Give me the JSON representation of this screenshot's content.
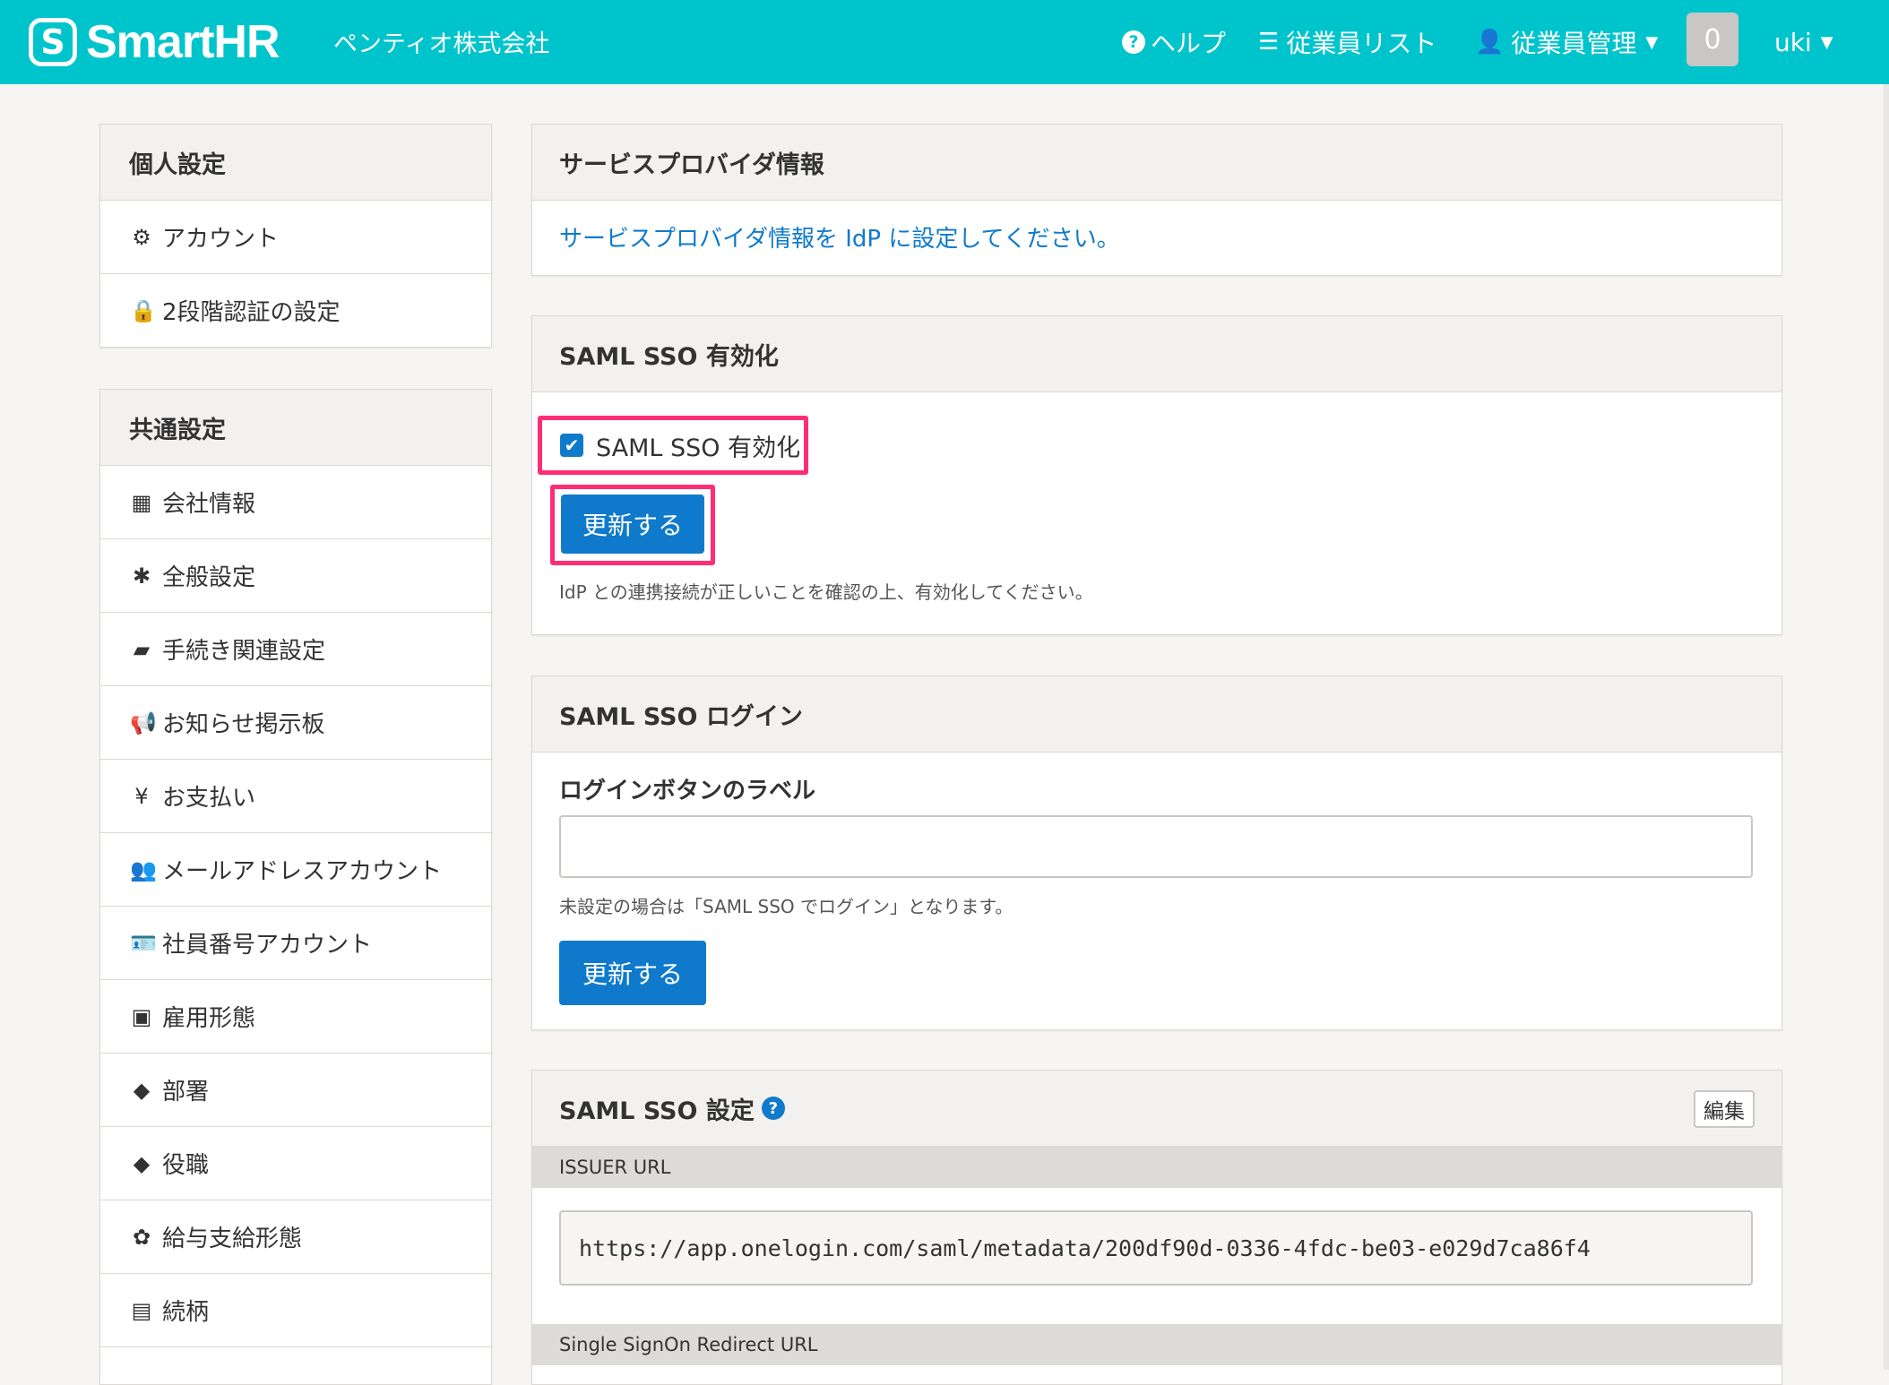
{
  "header": {
    "logo_mark": "S",
    "logo_text": "SmartHR",
    "company": "ペンティオ株式会社",
    "nav_help": "ヘルプ",
    "nav_employee_list": "従業員リスト",
    "nav_employee_manage": "従業員管理",
    "notification_count": "0",
    "user": "uki",
    "brand_color": "#00c4cc"
  },
  "sidebar": {
    "personal_title": "個人設定",
    "personal_items": [
      {
        "label": "アカウント",
        "icon": "gear-icon"
      },
      {
        "label": "2段階認証の設定",
        "icon": "lock-icon"
      }
    ],
    "common_title": "共通設定",
    "common_items": [
      {
        "label": "会社情報",
        "icon": "building-icon"
      },
      {
        "label": "全般設定",
        "icon": "asterisk-icon"
      },
      {
        "label": "手続き関連設定",
        "icon": "book-icon"
      },
      {
        "label": "お知らせ掲示板",
        "icon": "megaphone-icon"
      },
      {
        "label": "お支払い",
        "icon": "yen-icon"
      },
      {
        "label": "メールアドレスアカウント",
        "icon": "users-icon"
      },
      {
        "label": "社員番号アカウント",
        "icon": "id-card-icon"
      },
      {
        "label": "雇用形態",
        "icon": "badge-icon"
      },
      {
        "label": "部署",
        "icon": "tags-icon"
      },
      {
        "label": "役職",
        "icon": "tag-icon"
      },
      {
        "label": "給与支給形態",
        "icon": "money-icon"
      },
      {
        "label": "続柄",
        "icon": "contact-icon"
      }
    ]
  },
  "sp_info": {
    "title": "サービスプロバイダ情報",
    "link": "サービスプロバイダ情報を IdP に設定してください。"
  },
  "sso_enable": {
    "title": "SAML SSO 有効化",
    "checkbox_label": "SAML SSO 有効化",
    "checked": true,
    "button": "更新する",
    "help": "IdP との連携接続が正しいことを確認の上、有効化してください。"
  },
  "sso_login": {
    "title": "SAML SSO ログイン",
    "field_label": "ログインボタンのラベル",
    "field_value": "",
    "help": "未設定の場合は「SAML SSO でログイン」となります。",
    "button": "更新する"
  },
  "sso_settings": {
    "title": "SAML SSO 設定",
    "edit": "編集",
    "issuer_label": "ISSUER URL",
    "issuer_value": "https://app.onelogin.com/saml/metadata/200df90d-0336-4fdc-be03-e029d7ca86f4",
    "redirect_label": "Single SignOn Redirect URL"
  },
  "colors": {
    "accent": "#0f7acb",
    "highlight": "#ff2e74"
  }
}
